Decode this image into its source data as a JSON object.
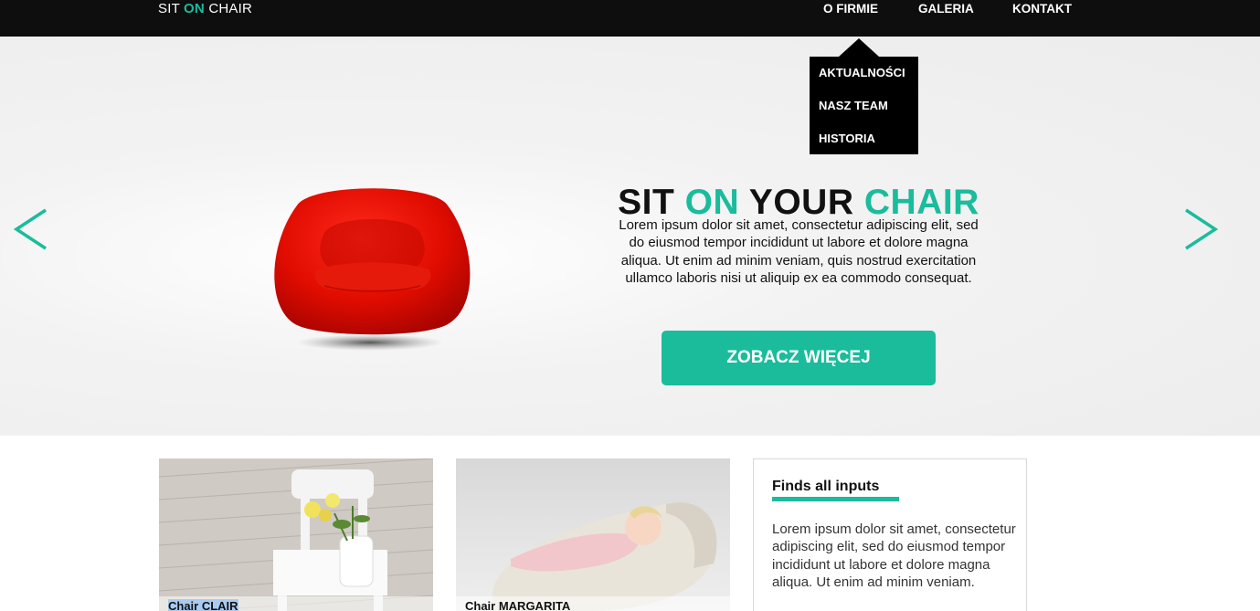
{
  "brand": {
    "part1": "SIT ",
    "part2": "ON",
    "part3": " CHAIR",
    "accent_color": "#1abc9c"
  },
  "nav": {
    "items": [
      {
        "label": "O FIRMIE"
      },
      {
        "label": "GALERIA"
      },
      {
        "label": "KONTAKT"
      }
    ]
  },
  "dropdown": {
    "items": [
      {
        "label": "AKTUALNOŚCI"
      },
      {
        "label": "NASZ TEAM"
      },
      {
        "label": "HISTORIA"
      }
    ]
  },
  "hero": {
    "title_1": "SIT ",
    "title_2": "ON",
    "title_3": " YOUR ",
    "title_4": "CHAIR",
    "text": "Lorem ipsum dolor sit amet, consectetur adipiscing elit, sed do eiusmod tempor incididunt ut labore et dolore magna aliqua. Ut enim ad minim veniam, quis nostrud exercitation ullamco laboris nisi ut aliquip ex ea commodo consequat.",
    "button_label": "ZOBACZ WIĘCEJ",
    "prev_icon": "chevron-left-icon",
    "next_icon": "chevron-right-icon"
  },
  "cards": [
    {
      "caption": "Chair CLAIR"
    },
    {
      "caption": "Chair MARGARITA"
    }
  ],
  "info": {
    "title": "Finds all inputs",
    "text": "Lorem ipsum dolor sit amet, consectetur adipiscing elit, sed do eiusmod tempor incididunt ut labore et dolore magna aliqua. Ut enim ad minim veniam."
  }
}
